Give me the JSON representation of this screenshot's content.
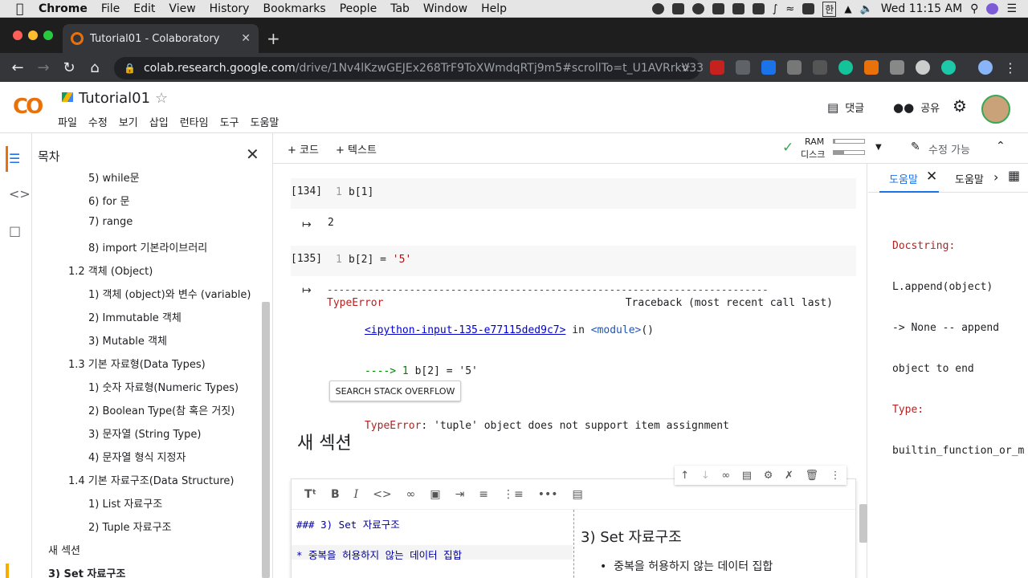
{
  "macos": {
    "app": "Chrome",
    "menus": [
      "File",
      "Edit",
      "View",
      "History",
      "Bookmarks",
      "People",
      "Tab",
      "Window",
      "Help"
    ],
    "clock": "Wed 11:15 AM",
    "ime": "한"
  },
  "browser": {
    "tab_title": "Tutorial01 - Colaboratory",
    "url_host": "colab.research.google.com",
    "url_path": "/drive/1Nv4lKzwGEJEx268TrF9ToXWmdqRTj9m5#scrollTo=t_U1AVRrkV33"
  },
  "colab": {
    "logo": "CO",
    "title": "Tutorial01",
    "menus": [
      "파일",
      "수정",
      "보기",
      "삽입",
      "런타임",
      "도구",
      "도움말"
    ],
    "comment_label": "댓글",
    "share_label": "공유",
    "add_code": "+ 코드",
    "add_text": "+ 텍스트",
    "ram_label": "RAM",
    "disk_label": "디스크",
    "ram_fraction": 0.05,
    "disk_fraction": 0.35,
    "edit_label": "수정 가능"
  },
  "toc": {
    "heading": "목차",
    "items": [
      {
        "label": "5) while문",
        "level": 2
      },
      {
        "label": "6) for 문",
        "level": 2
      },
      {
        "label": "7) range",
        "level": 2
      },
      {
        "label": "8) import 기본라이브러리",
        "level": 2
      },
      {
        "label": "1.2 객체 (Object)",
        "level": 1
      },
      {
        "label": "1) 객체 (object)와 변수 (variable)",
        "level": 2
      },
      {
        "label": "2) Immutable 객체",
        "level": 2
      },
      {
        "label": "3) Mutable 객체",
        "level": 2
      },
      {
        "label": "1.3 기본 자료형(Data Types)",
        "level": 1
      },
      {
        "label": "1) 숫자 자료형(Numeric Types)",
        "level": 2
      },
      {
        "label": "2) Boolean Type(참 혹은 거짓)",
        "level": 2
      },
      {
        "label": "3) 문자열 (String Type)",
        "level": 2
      },
      {
        "label": "4) 문자열 형식 지정자",
        "level": 2
      },
      {
        "label": "1.4 기본 자료구조(Data Structure)",
        "level": 1
      },
      {
        "label": "1) List 자료구조",
        "level": 2
      },
      {
        "label": "2) Tuple 자료구조",
        "level": 2
      },
      {
        "label": "새 섹션",
        "level": 0
      },
      {
        "label": "3) Set 자료구조",
        "level": 0,
        "active": true
      }
    ]
  },
  "cells": {
    "c134": {
      "num": "[134]",
      "line": "1",
      "code": "b[1]",
      "output": "2"
    },
    "c135": {
      "num": "[135]",
      "line": "1",
      "code_pre": "b[2] = ",
      "code_str": "'5'"
    },
    "error": {
      "dashes": "---------------------------------------------------------------------------",
      "type": "TypeError",
      "traceback": "Traceback (most recent call last)",
      "link": "<ipython-input-135-e77115ded9c7>",
      "in": " in ",
      "module": "<module>",
      "paren": "()",
      "arrow": "----> 1 ",
      "arrow_code": "b[2] = '5'",
      "msg_type": "TypeError",
      "msg": ": 'tuple' object does not support item assignment",
      "so_button": "SEARCH STACK OVERFLOW"
    },
    "section_title": "새 섹션",
    "text_cell": {
      "src_line1": "### 3) Set 자료구조",
      "src_line2": "* 중복을 허용하지 않는 데이터 집합",
      "preview_heading": "3) Set 자료구조",
      "preview_bullet": "중복을 허용하지 않는 데이터 집합"
    }
  },
  "help": {
    "tab1": "도움말",
    "tab2": "도움말",
    "docstring_label": "Docstring:",
    "doc_lines": [
      "L.append(object)",
      "-> None -- append",
      "object to end"
    ],
    "type_label": "Type:",
    "type_value": "builtin_function_or_m"
  },
  "colors": {
    "accent": "#1a73e8",
    "colab_orange": "#f9ab00",
    "error_red": "#b22222"
  }
}
